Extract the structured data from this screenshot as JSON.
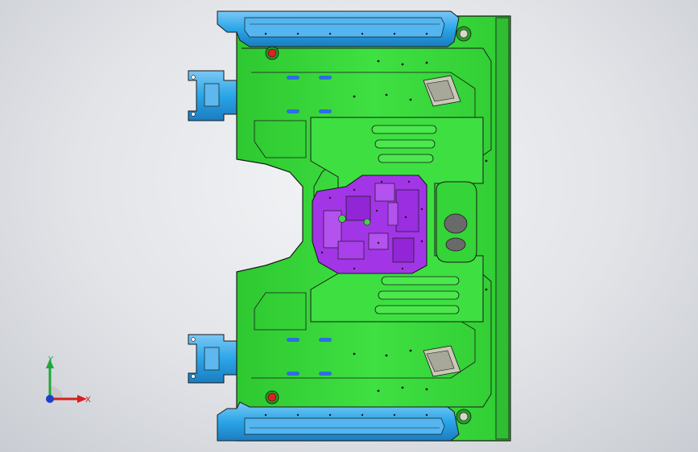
{
  "app": {
    "window": "cad-3d-viewport"
  },
  "triad": {
    "x_label": "X",
    "y_label": "Y"
  },
  "colors": {
    "background_center": "#f3f4f6",
    "background_edge": "#c9ccd2",
    "base_plate": "#38d83a",
    "rail": "#2aa6e8",
    "insert": "#a236e6",
    "outline": "#1a1a1a",
    "bolt_red": "#e02020",
    "slot_blue": "#2d6fe0",
    "axis_x": "#d42020",
    "axis_y": "#1ea83a",
    "axis_z": "#1a3fd0"
  },
  "model": {
    "parts": [
      {
        "name": "mold-base-plate",
        "color": "base_plate"
      },
      {
        "name": "slide-rail-top",
        "color": "rail"
      },
      {
        "name": "slide-rail-bottom",
        "color": "rail"
      },
      {
        "name": "side-bracket-top",
        "color": "rail"
      },
      {
        "name": "side-bracket-bottom",
        "color": "rail"
      },
      {
        "name": "center-insert",
        "color": "insert"
      }
    ]
  }
}
